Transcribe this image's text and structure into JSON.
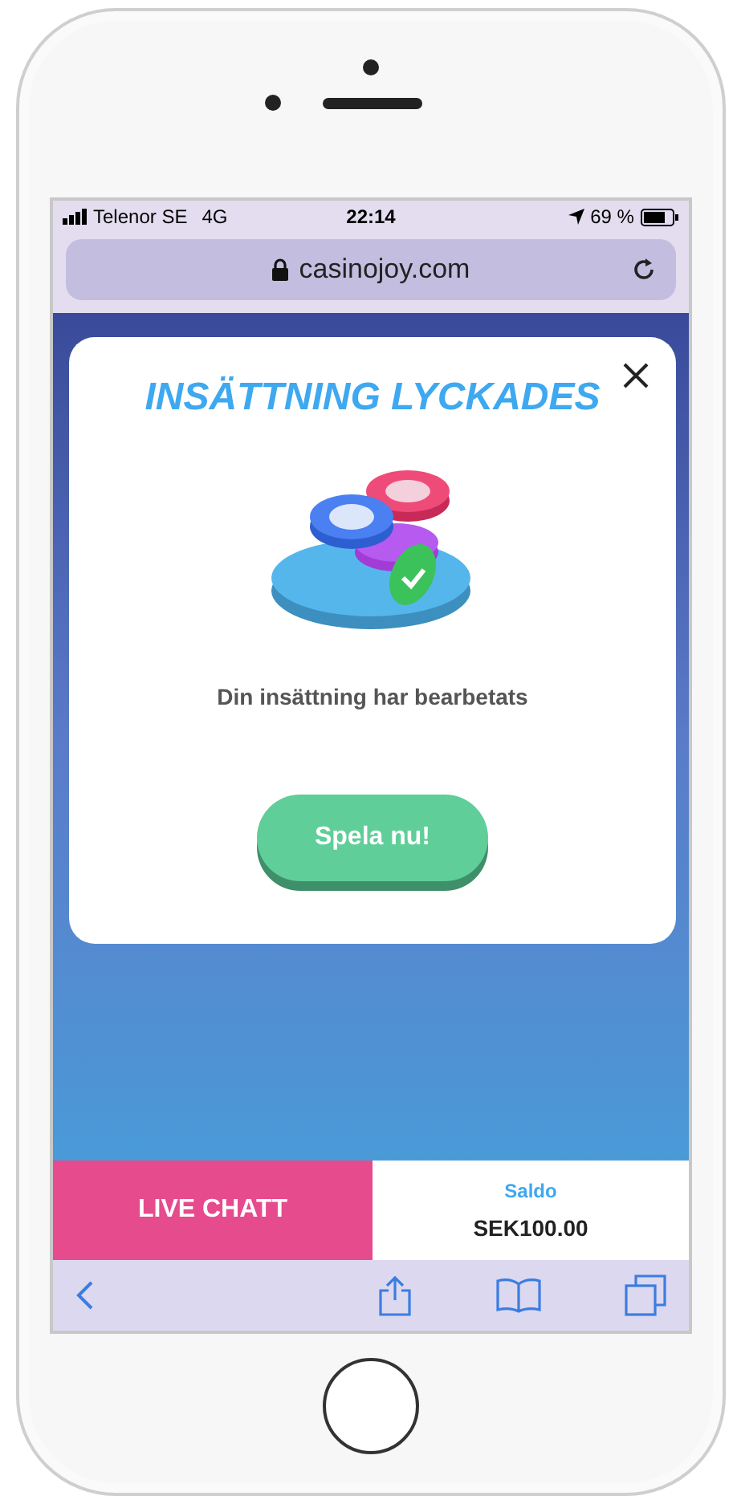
{
  "status_bar": {
    "carrier": "Telenor SE",
    "network": "4G",
    "time": "22:14",
    "battery": "69 %"
  },
  "address_bar": {
    "url": "casinojoy.com"
  },
  "modal": {
    "title": "INSÄTTNING LYCKADES",
    "message": "Din insättning har bearbetats",
    "button": "Spela nu!"
  },
  "bottom_bar": {
    "live_chat": "LIVE CHATT",
    "balance_label": "Saldo",
    "balance": "SEK100.00"
  }
}
